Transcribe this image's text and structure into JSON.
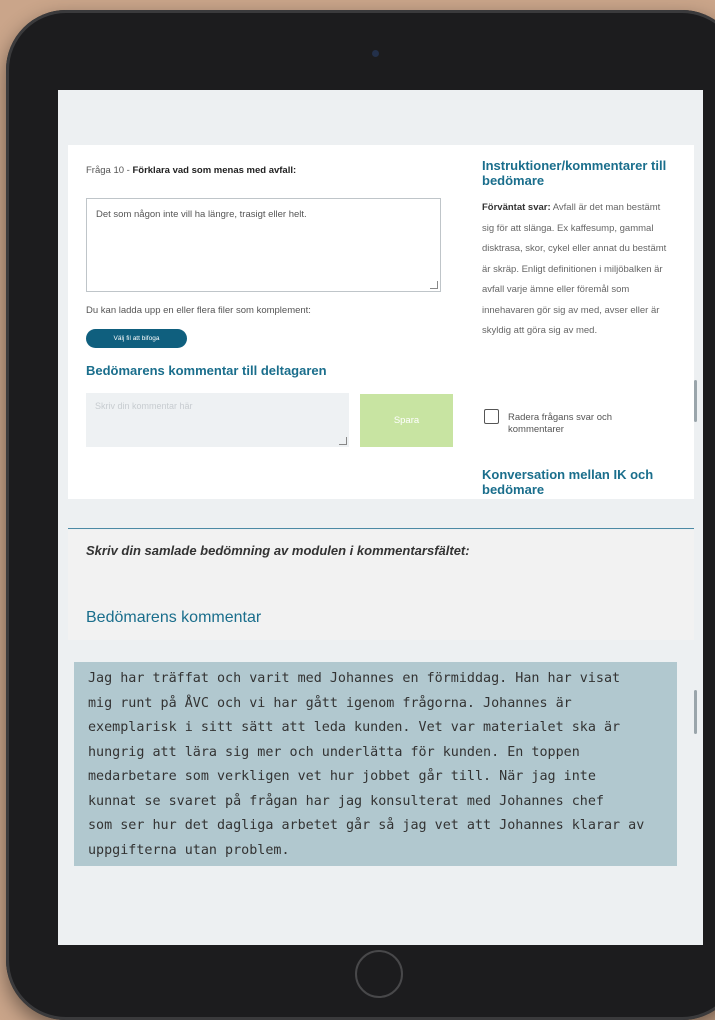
{
  "question": {
    "prefix": "Fråga 10 - ",
    "title": "Förklara vad som menas med avfall:",
    "answer_text": "Det som någon inte vill ha längre, trasigt eller helt."
  },
  "upload": {
    "label": "Du kan ladda upp en eller flera filer som komplement:",
    "button": "Välj fil att bifoga"
  },
  "assessor_comment": {
    "heading": "Bedömarens kommentar till deltagaren",
    "placeholder": "Skriv din kommentar här",
    "save_button": "Spara"
  },
  "instructions": {
    "heading": "Instruktioner/kommentarer till bedömare",
    "expected_label": "Förväntat svar:",
    "expected_text": " Avfall är det man bestämt sig för att slänga. Ex kaffesump, gammal disktrasa, skor, cykel eller annat du bestämt är skräp. Enligt definitionen i miljöbalken är avfall varje ämne eller föremål som innehavaren gör sig av med, avser eller är skyldig att göra sig av med.",
    "delete_checkbox_label": "Radera frågans svar och kommentarer",
    "conversation_heading": "Konversation mellan IK och bedömare"
  },
  "summary": {
    "prompt": "Skriv din samlade bedömning av modulen i kommentarsfältet:",
    "heading": "Bedömarens kommentar",
    "comment": "Jag har träffat och varit med Johannes en förmiddag. Han har visat\nmig runt på ÅVC och vi har gått igenom frågorna. Johannes är\nexemplarisk i sitt sätt att leda kunden. Vet var materialet ska är\nhungrig att lära sig mer och underlätta för kunden. En toppen\nmedarbetare som verkligen vet hur jobbet går till. När jag inte\nkunnat se svaret på frågan har jag konsulterat med Johannes chef\nsom ser hur det dagliga arbetet går så jag vet att Johannes klarar av\nuppgifterna utan problem."
  },
  "colors": {
    "accent": "#1a6e8c",
    "button_dark": "#0f5f7e",
    "save_button": "#c8e4a2",
    "comment_background": "#b1c8cf"
  }
}
